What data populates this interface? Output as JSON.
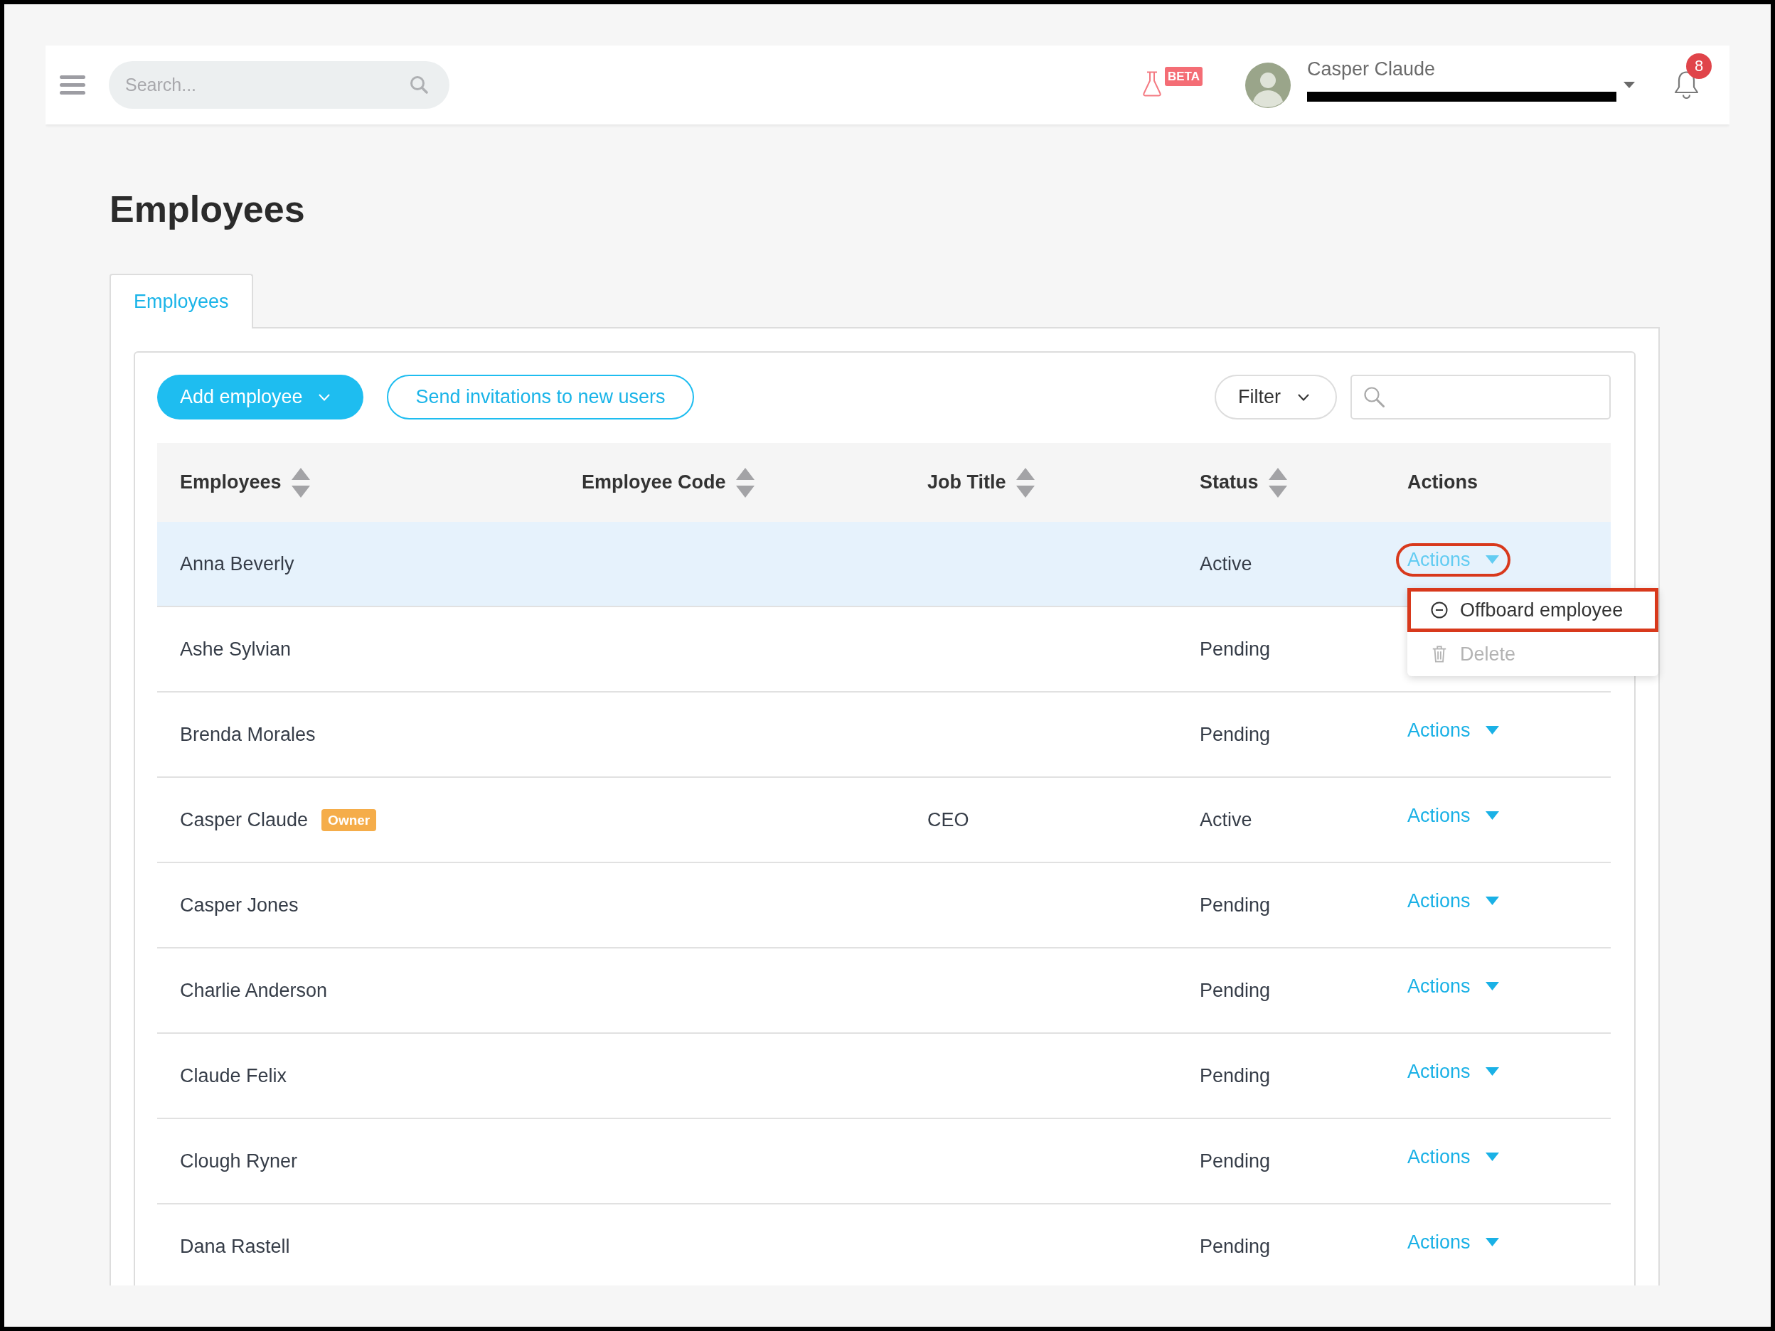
{
  "header": {
    "search": {
      "placeholder": "Search..."
    },
    "beta_label": "BETA",
    "user": {
      "name": "Casper Claude",
      "email_redacted": true
    },
    "notification_count": "8"
  },
  "page_title": "Employees",
  "tabs": [
    {
      "label": "Employees",
      "selected": true
    }
  ],
  "toolbar": {
    "add_button": "Add employee",
    "invite_button": "Send invitations to new users",
    "filter_button": "Filter"
  },
  "table": {
    "columns": [
      {
        "label": "Employees",
        "sortable": true
      },
      {
        "label": "Employee Code",
        "sortable": true
      },
      {
        "label": "Job Title",
        "sortable": true
      },
      {
        "label": "Status",
        "sortable": true
      },
      {
        "label": "Actions",
        "sortable": false
      }
    ],
    "rows": [
      {
        "name": "Anna Beverly",
        "status": "Active",
        "actions": "Actions",
        "selected": true,
        "menu_open": true,
        "highlighted": true
      },
      {
        "name": "Ashe Sylvian",
        "status": "Pending",
        "selected": false
      },
      {
        "name": "Brenda Morales",
        "status": "Pending",
        "actions": "Actions",
        "selected": false,
        "menu_open": false,
        "highlighted": false
      },
      {
        "name": "Casper Claude",
        "badge": "Owner",
        "job_title": "CEO",
        "status": "Active",
        "actions": "Actions",
        "selected": false,
        "menu_open": false,
        "highlighted": false
      },
      {
        "name": "Casper Jones",
        "status": "Pending",
        "actions": "Actions",
        "selected": false,
        "menu_open": false,
        "highlighted": false
      },
      {
        "name": "Charlie Anderson",
        "status": "Pending",
        "actions": "Actions",
        "selected": false,
        "menu_open": false,
        "highlighted": false
      },
      {
        "name": "Claude Felix",
        "status": "Pending",
        "actions": "Actions",
        "selected": false,
        "menu_open": false,
        "highlighted": false
      },
      {
        "name": "Clough Ryner",
        "status": "Pending",
        "actions": "Actions",
        "selected": false,
        "menu_open": false,
        "highlighted": false
      },
      {
        "name": "Dana Rastell",
        "status": "Pending",
        "actions": "Actions",
        "selected": false,
        "menu_open": false,
        "highlighted": false
      }
    ]
  },
  "actions_menu": {
    "items": [
      {
        "kind": "offboard",
        "label": "Offboard employee",
        "disabled": false,
        "highlighted": true
      },
      {
        "kind": "delete",
        "label": "Delete",
        "disabled": true,
        "highlighted": false
      }
    ]
  }
}
